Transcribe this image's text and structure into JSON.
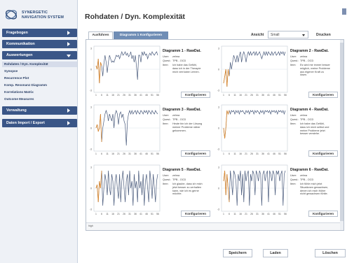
{
  "app": {
    "logo_line1": "SYNERGETIC",
    "logo_line2": "NAVIGATION SYSTEM"
  },
  "sidebar": {
    "items": [
      {
        "label": "Fragebogen",
        "expanded": false
      },
      {
        "label": "Kommunikation",
        "expanded": false
      },
      {
        "label": "Auswertungen",
        "expanded": true
      },
      {
        "label": "Verwaltung",
        "expanded": false
      },
      {
        "label": "Daten Import / Export",
        "expanded": false
      }
    ],
    "subitems": [
      {
        "label": "Rohdaten / Dyn. Komplexität",
        "active": true
      },
      {
        "label": "Synopse",
        "active": false
      },
      {
        "label": "Recurrence Plot",
        "active": false
      },
      {
        "label": "Komp. Resonanz Diagramm",
        "active": false
      },
      {
        "label": "Korrelations Matrix",
        "active": false
      },
      {
        "label": "Outcome Measures",
        "active": false
      }
    ]
  },
  "header": {
    "title": "Rohdaten / Dyn. Komplexität"
  },
  "toolbar": {
    "tab_ausfuhren": "Ausführen",
    "tab_diagramm": "Diagramm 1 Konfigurieren",
    "ansicht_label": "Ansicht",
    "ansicht_value": "Small",
    "print_label": "Drucken"
  },
  "diagrams": [
    {
      "title": "Diagramm 1 - RawDat.",
      "user_key": "User:",
      "user": "zelma",
      "quest_key": "Quest.:",
      "quest": "TPB - OCD",
      "item_key": "Item:",
      "item": "Ich habe das Gefühl, dass ich in der Therapie mich verrückte Lernen.",
      "config": "Konfigurieren"
    },
    {
      "title": "Diagramm 2 - RawDat.",
      "user_key": "User:",
      "user": "zelma",
      "quest_key": "Quest.:",
      "quest": "TPB - OCD",
      "item_key": "Item:",
      "item": "Es wird mir immer besser möglich, meine Probleme aus eigener Kraft zu lösen.",
      "config": "Konfigurieren"
    },
    {
      "title": "Diagramm 3 - RawDat.",
      "user_key": "User:",
      "user": "zelma",
      "quest_key": "Quest.:",
      "quest": "TPB - OCD",
      "item_key": "Item:",
      "item": "Heute bin ich der Lösung meiner Probleme näher gekommen.",
      "config": "Konfigurieren"
    },
    {
      "title": "Diagramm 4 - RawDat.",
      "user_key": "User:",
      "user": "zelma",
      "quest_key": "Quest.:",
      "quest": "TPB - OCD",
      "item_key": "Item:",
      "item": "Ich habe das Gefühl, dass ich mich selbst und meine Probleme jetzt besser verstehe.",
      "config": "Konfigurieren"
    },
    {
      "title": "Diagramm 5 - RawDat.",
      "user_key": "User:",
      "user": "zelma",
      "quest_key": "Quest.:",
      "quest": "TPB - OCD",
      "item_key": "Item:",
      "item": "Ich glaube, dass ich mich jetzt besser zu verhalten kann, wie ich es gerne möchte.",
      "config": "Konfigurieren"
    },
    {
      "title": "Diagramm 6 - RawDat.",
      "user_key": "User:",
      "user": "zelma",
      "quest_key": "Quest.:",
      "quest": "TPB - OCD",
      "item_key": "Item:",
      "item": "Ich fühle mich jetzt Situationen gewachsen, denen ich mich früher nicht gewachsen fühlte.",
      "config": "Konfigurieren"
    }
  ],
  "bottom_strip": {
    "label": "high"
  },
  "footer": {
    "save": "Speichern",
    "load": "Laden",
    "delete": "Löschen"
  },
  "colors": {
    "nav_bg": "#3a5687",
    "series_line": "#4a5b7c",
    "highlight_line": "#e08a2c",
    "tab_active": "#6f8db5"
  },
  "chart_data": [
    {
      "type": "line",
      "y_ticks": [
        3,
        0,
        -3
      ],
      "ylim": [
        -3,
        3
      ],
      "x_ticks": [
        1,
        6,
        11,
        16,
        21,
        26,
        31,
        36,
        41,
        46,
        51,
        56
      ],
      "series": [
        {
          "values": [
            0.5,
            0,
            1.5,
            -2,
            1,
            0.5,
            -1,
            0.8,
            2,
            1,
            -0.5,
            1,
            2,
            1.5,
            1,
            1.2,
            1,
            1.5,
            2,
            1.8,
            2,
            1.5,
            2,
            2.5,
            2,
            2.2,
            2.5,
            2,
            2.3,
            1.8,
            2,
            2.5,
            1.5,
            2,
            1,
            2,
            0.5,
            -1.5,
            2,
            2,
            1,
            2.5,
            2,
            2.5,
            2,
            2.2,
            1.5,
            2,
            2.3,
            2,
            2.5,
            2.2,
            2,
            2.3,
            2.5,
            2
          ]
        }
      ]
    },
    {
      "type": "line",
      "y_ticks": [
        3,
        0,
        -3
      ],
      "ylim": [
        -3,
        3
      ],
      "x_ticks": [
        1,
        6,
        11,
        16,
        21,
        26,
        31,
        36,
        41,
        46,
        51,
        56
      ],
      "series": [
        {
          "values": [
            -2,
            -1,
            0,
            -2.5,
            0,
            -1,
            1,
            0,
            1,
            2,
            1.5,
            1,
            2,
            1,
            2,
            2.5,
            1,
            2,
            2.5,
            2,
            1,
            2,
            2.5,
            2,
            2.5,
            2,
            2.3,
            2.5,
            2,
            2.5,
            2,
            2.2,
            2.5,
            2,
            1.5,
            2,
            2.5,
            2,
            2.5,
            2,
            2.5,
            2.2,
            2,
            2.5,
            2,
            2.3,
            2.5,
            2,
            2.2,
            2.5,
            2,
            2.5,
            2.2,
            2.5,
            2,
            2.5
          ]
        }
      ]
    },
    {
      "type": "line",
      "y_ticks": [
        3,
        0,
        -3
      ],
      "ylim": [
        -3,
        3
      ],
      "x_ticks": [
        1,
        6,
        11,
        16,
        21,
        26,
        31,
        36,
        41,
        46,
        51,
        56
      ],
      "series": [
        {
          "values": [
            0,
            0.5,
            -0.5,
            0,
            2,
            -2,
            0,
            1,
            2,
            2.5,
            2,
            1,
            2,
            1.5,
            1,
            2,
            0,
            2,
            2.5,
            2,
            0.5,
            2,
            2.3,
            1.5,
            2,
            1,
            0.5,
            -2.5,
            1,
            2,
            2.5,
            2,
            2.5,
            2,
            2.3,
            2.5,
            2,
            2.5,
            2.2,
            2,
            2.5,
            2.3,
            2,
            2.5,
            2.2,
            2.5,
            2,
            2.5,
            2.3,
            2,
            2.5,
            2.2,
            2,
            2.5,
            2.2,
            2
          ]
        }
      ]
    },
    {
      "type": "line",
      "y_ticks": [
        3,
        0,
        -3
      ],
      "ylim": [
        -3,
        3
      ],
      "x_ticks": [
        1,
        6,
        11,
        16,
        21,
        26,
        31,
        36,
        41,
        46,
        51,
        56
      ],
      "series": [
        {
          "values": [
            0,
            -1.5,
            0,
            2.5,
            2,
            2.5,
            2,
            2.5,
            2.3,
            2.5,
            2,
            2.5,
            2.2,
            2.5,
            2,
            2.5,
            2.3,
            2.5,
            2.2,
            2,
            2.5,
            2.2,
            2.5,
            2,
            2.5,
            2.3,
            2.5,
            2,
            2.5,
            2.2,
            2.5,
            2.3,
            2,
            2.5,
            2.2,
            2.5,
            2,
            2.5,
            2.3,
            2.5,
            2.2,
            2.5,
            2,
            2.5,
            2.3,
            2.5,
            2.2,
            2.5,
            2,
            2.5,
            2.3,
            2.5,
            2.2,
            2.5,
            2,
            2.5
          ]
        }
      ]
    },
    {
      "type": "line",
      "y_ticks": [
        3,
        0,
        -3
      ],
      "ylim": [
        -3,
        3
      ],
      "x_ticks": [
        1,
        6,
        11,
        16,
        21,
        26,
        31,
        36,
        41,
        46,
        51,
        56
      ],
      "series": [
        {
          "values": [
            0,
            0.5,
            -2,
            1,
            0,
            2.5,
            -2.5,
            0,
            2,
            1,
            -1,
            2.5,
            0,
            -1,
            2,
            1,
            -2.5,
            1,
            2,
            0,
            -1.5,
            2,
            -2,
            1,
            2.5,
            0,
            -2,
            1,
            2,
            -1,
            2.5,
            0,
            1,
            -2.5,
            2,
            0,
            1,
            -2,
            2.5,
            0,
            1,
            -1,
            2,
            -2.5,
            1,
            2,
            0,
            -2,
            2.5,
            1,
            -1.5,
            2,
            0,
            -2,
            1,
            2
          ]
        }
      ]
    },
    {
      "type": "line",
      "y_ticks": [
        3,
        0,
        -3
      ],
      "ylim": [
        -3,
        3
      ],
      "x_ticks": [
        1,
        6,
        11,
        16,
        21,
        26,
        31,
        36,
        41,
        46,
        51,
        56
      ],
      "series": [
        {
          "values": [
            1,
            2.5,
            -1,
            2,
            0,
            -2,
            2.5,
            1,
            -1,
            2.5,
            2,
            1,
            -2.5,
            2,
            1,
            2.5,
            -1,
            2,
            -2,
            2.5,
            1,
            2,
            2.5,
            -2.5,
            2,
            1,
            2.5,
            2,
            -1,
            2.5,
            2,
            1,
            2.5,
            2,
            -2.5,
            2,
            2.5,
            1,
            2,
            2.5,
            -2,
            2.5,
            2,
            1,
            2.5,
            2,
            -1,
            2.5,
            2,
            2.5,
            1,
            2,
            2.5,
            -2.5,
            2,
            2.5
          ]
        }
      ]
    }
  ]
}
